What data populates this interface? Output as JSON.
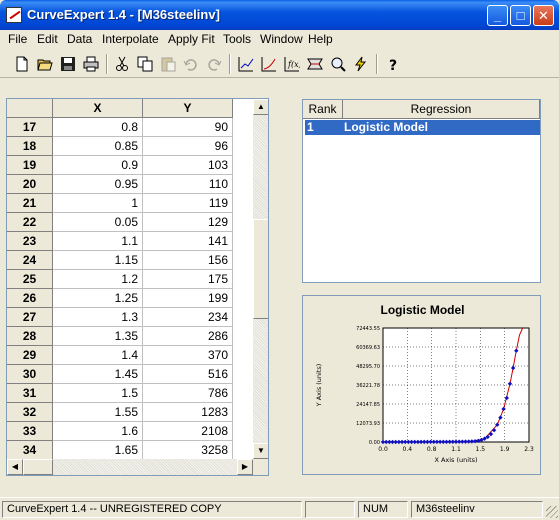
{
  "window": {
    "title": "CurveExpert 1.4 - [M36steelinv]"
  },
  "menu": [
    "File",
    "Edit",
    "Data",
    "Interpolate",
    "Apply Fit",
    "Tools",
    "Window",
    "Help"
  ],
  "toolbar": {
    "buttons": [
      "new-file-icon",
      "open-folder-icon",
      "save-icon",
      "print-icon",
      "cut-icon",
      "copy-icon",
      "paste-icon",
      "undo-icon",
      "redo-icon",
      "plot-data-icon",
      "curve-fit-icon",
      "fx-function-icon",
      "curve-finder-icon",
      "zoom-graph-icon",
      "quick-fit-icon",
      "help-icon"
    ]
  },
  "sheet": {
    "columns": [
      "X",
      "Y"
    ],
    "rows": [
      {
        "n": "17",
        "x": "0.8",
        "y": "90"
      },
      {
        "n": "18",
        "x": "0.85",
        "y": "96"
      },
      {
        "n": "19",
        "x": "0.9",
        "y": "103"
      },
      {
        "n": "20",
        "x": "0.95",
        "y": "110"
      },
      {
        "n": "21",
        "x": "1",
        "y": "119"
      },
      {
        "n": "22",
        "x": "0.05",
        "y": "129"
      },
      {
        "n": "23",
        "x": "1.1",
        "y": "141"
      },
      {
        "n": "24",
        "x": "1.15",
        "y": "156"
      },
      {
        "n": "25",
        "x": "1.2",
        "y": "175"
      },
      {
        "n": "26",
        "x": "1.25",
        "y": "199"
      },
      {
        "n": "27",
        "x": "1.3",
        "y": "234"
      },
      {
        "n": "28",
        "x": "1.35",
        "y": "286"
      },
      {
        "n": "29",
        "x": "1.4",
        "y": "370"
      },
      {
        "n": "30",
        "x": "1.45",
        "y": "516"
      },
      {
        "n": "31",
        "x": "1.5",
        "y": "786"
      },
      {
        "n": "32",
        "x": "1.55",
        "y": "1283"
      },
      {
        "n": "33",
        "x": "1.6",
        "y": "2108"
      },
      {
        "n": "34",
        "x": "1.65",
        "y": "3258"
      }
    ]
  },
  "results": {
    "headers": [
      "Rank",
      "Regression"
    ],
    "rows": [
      {
        "rank": "1",
        "name": "Logistic Model"
      }
    ]
  },
  "graph": {
    "title": "Logistic Model",
    "xlabel": "X Axis (units)",
    "ylabel": "Y Axis (units)",
    "xticks": [
      "0.0",
      "0.4",
      "0.8",
      "1.1",
      "1.5",
      "1.9",
      "2.3"
    ],
    "yticks": [
      "0.00",
      "12073.93",
      "24147.85",
      "36221.78",
      "48295.70",
      "60369.63",
      "72443.55"
    ],
    "colors": {
      "points": "#1010c0",
      "curve": "#cc0000"
    }
  },
  "chart_data": {
    "type": "scatter",
    "title": "Logistic Model",
    "xlabel": "X Axis (units)",
    "ylabel": "Y Axis (units)",
    "xlim": [
      0.0,
      2.3
    ],
    "ylim": [
      0.0,
      72443.55
    ],
    "grid": true,
    "series": [
      {
        "name": "data",
        "x": [
          0.0,
          0.05,
          0.1,
          0.15,
          0.2,
          0.25,
          0.3,
          0.35,
          0.4,
          0.45,
          0.5,
          0.55,
          0.6,
          0.65,
          0.7,
          0.75,
          0.8,
          0.85,
          0.9,
          0.95,
          1.0,
          1.05,
          1.1,
          1.15,
          1.2,
          1.25,
          1.3,
          1.35,
          1.4,
          1.45,
          1.5,
          1.55,
          1.6,
          1.65,
          1.7,
          1.75,
          1.8,
          1.85,
          1.9,
          1.95,
          2.0,
          2.05,
          2.1
        ],
        "y": [
          20,
          22,
          25,
          28,
          32,
          36,
          40,
          45,
          50,
          56,
          62,
          68,
          74,
          80,
          85,
          88,
          90,
          96,
          103,
          110,
          119,
          129,
          141,
          156,
          175,
          199,
          234,
          286,
          370,
          516,
          786,
          1283,
          2108,
          3258,
          5000,
          7500,
          11000,
          15500,
          21000,
          28000,
          37000,
          47000,
          58000
        ]
      },
      {
        "name": "fit",
        "x": [
          1.2,
          1.4,
          1.6,
          1.8,
          1.9,
          2.0,
          2.05,
          2.1,
          2.15,
          2.2
        ],
        "y": [
          0,
          300,
          2100,
          11000,
          21000,
          37000,
          47000,
          58000,
          68000,
          80000
        ]
      }
    ]
  },
  "status": {
    "main": "CurveExpert 1.4 -- UNREGISTERED COPY",
    "panel2": "",
    "num": "NUM",
    "file": "M36steelinv"
  }
}
